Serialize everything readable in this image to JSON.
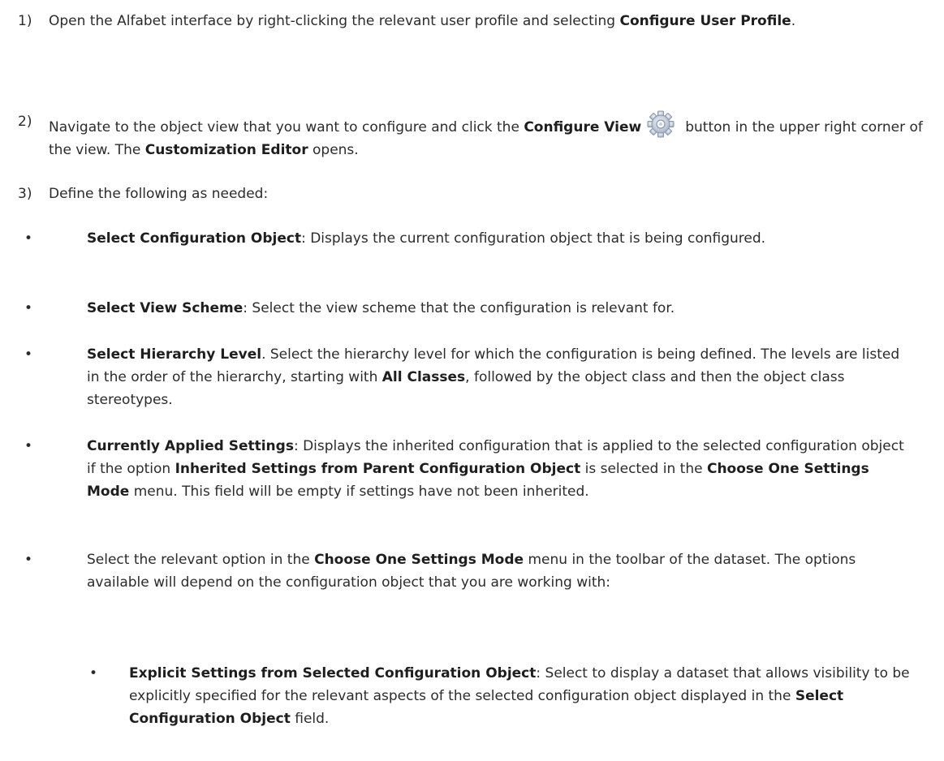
{
  "steps": [
    {
      "number": "1)",
      "parts": [
        {
          "t": "Open the Alfabet interface by right-clicking the relevant user profile and selecting ",
          "b": false
        },
        {
          "t": "Configure User Profile",
          "b": true
        },
        {
          "t": ".",
          "b": false
        }
      ]
    },
    {
      "number": "2)",
      "parts_before_icon": [
        {
          "t": "Navigate to the object view that you want to configure and click the ",
          "b": false
        },
        {
          "t": "Configure View",
          "b": true
        }
      ],
      "icon": "gear-icon",
      "parts_after_icon": [
        {
          "t": "button in the upper right corner of the view. The ",
          "b": false
        },
        {
          "t": "Customization Editor",
          "b": true
        },
        {
          "t": " opens.",
          "b": false
        }
      ]
    },
    {
      "number": "3)",
      "parts": [
        {
          "t": "Define the following as needed:",
          "b": false
        }
      ]
    }
  ],
  "bullets": [
    {
      "parts": [
        {
          "t": "Select Configuration Object",
          "b": true
        },
        {
          "t": ": Displays the current configuration object that is being configured.",
          "b": false
        }
      ]
    },
    {
      "parts": [
        {
          "t": "Select View Scheme",
          "b": true
        },
        {
          "t": ": Select the view scheme that the configuration is relevant for.",
          "b": false
        }
      ]
    },
    {
      "parts": [
        {
          "t": "Select Hierarchy Level",
          "b": true
        },
        {
          "t": ". Select the hierarchy level for which the configuration is being defined. The levels are listed in the order of the hierarchy, starting with ",
          "b": false
        },
        {
          "t": "All Classes",
          "b": true
        },
        {
          "t": ", followed by the object class and then the object class stereotypes.",
          "b": false
        }
      ]
    },
    {
      "parts": [
        {
          "t": "Currently Applied Settings",
          "b": true
        },
        {
          "t": ": Displays the inherited configuration that is applied to the selected configuration object if the option ",
          "b": false
        },
        {
          "t": "Inherited Settings from Parent Configuration Object",
          "b": true
        },
        {
          "t": " is selected in the ",
          "b": false
        },
        {
          "t": "Choose One Settings Mode",
          "b": true
        },
        {
          "t": " menu. This field will be empty if settings have not been inherited.",
          "b": false
        }
      ]
    },
    {
      "parts": [
        {
          "t": "Select the relevant option in the ",
          "b": false
        },
        {
          "t": "Choose One Settings Mode",
          "b": true
        },
        {
          "t": " menu in the toolbar of the dataset. The options available will depend on the configuration object that you are working with:",
          "b": false
        }
      ]
    }
  ],
  "sub_bullets": [
    {
      "parts": [
        {
          "t": "Explicit Settings from Selected Configuration Object",
          "b": true
        },
        {
          "t": ": Select to display a dataset that allows visibility to be explicitly specified for the relevant aspects of the selected configuration object displayed in the ",
          "b": false
        },
        {
          "t": "Select Configuration Object",
          "b": true
        },
        {
          "t": " field.",
          "b": false
        }
      ]
    }
  ],
  "bullet_glyph": "•",
  "colors": {
    "text": "#2b2b2b",
    "background": "#ffffff"
  }
}
